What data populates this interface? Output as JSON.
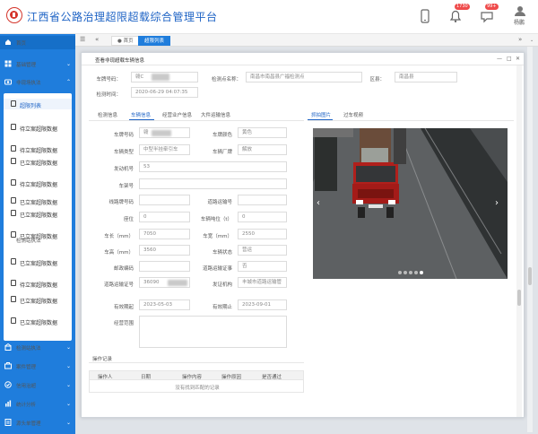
{
  "header": {
    "app_title": "江西省公路治理超限超载综合管理平台",
    "badge_alerts": "1730",
    "badge_msgs": "99+",
    "user": "杨鹏"
  },
  "sidebar": {
    "items": [
      {
        "label": "首页",
        "icon": "home-icon"
      },
      {
        "label": "基础管理",
        "icon": "grid-icon"
      },
      {
        "label": "非现场执法",
        "icon": "camera-icon"
      },
      {
        "label": "检测站执法",
        "icon": "station-icon"
      },
      {
        "label": "检测站执法",
        "icon": "station-icon"
      },
      {
        "label": "案件管理",
        "icon": "case-icon"
      },
      {
        "label": "信用治超",
        "icon": "credit-icon"
      },
      {
        "label": "统计分析",
        "icon": "chart-icon"
      },
      {
        "label": "源头单管理",
        "icon": "source-icon"
      }
    ],
    "group1": [
      {
        "label": "超限列表"
      },
      {
        "label": "待立案超限数据"
      },
      {
        "label": "待立案超限数据"
      },
      {
        "label": "已立案超限数据"
      },
      {
        "label": "待立案超限数据"
      },
      {
        "label": "已立案超限数据"
      },
      {
        "label": "已立案超限数据"
      },
      {
        "label": "已立案超限数据"
      }
    ],
    "group2": [
      {
        "label": "已立案超限数据"
      },
      {
        "label": "待立案超限数据"
      },
      {
        "label": "已立案超限数据"
      },
      {
        "label": "已立案超限数据"
      }
    ]
  },
  "tabbar": {
    "back": "«",
    "home_tab": "首页",
    "active_tab": "超限列表",
    "forward": "»"
  },
  "modal": {
    "title": "查看非现超载车辆信息",
    "ctrl_min": "—",
    "ctrl_max": "□",
    "ctrl_close": "✕",
    "plate_label": "车牌号码：",
    "plate_value": "赣C",
    "station_label": "检测点名称：",
    "station_value": "南昌市南昌县广福检测点",
    "area_label": "区县：",
    "area_value": "南昌县",
    "time_label": "检测时间：",
    "time_value": "2020-06-29 04:07:35",
    "subtabs": [
      "检测信息",
      "车辆信息",
      "经营业户信息",
      "大件运输信息"
    ],
    "active_subtab": "车辆信息",
    "photo_tabs": [
      "抓拍图片",
      "过车视频"
    ],
    "fields": {
      "plate_no_label": "车牌号码",
      "plate_no_value": "赣",
      "plate_color_label": "车牌颜色",
      "plate_color_value": "黄色",
      "vehicle_type_label": "车辆类型",
      "vehicle_type_value": "中型半挂牵引车",
      "brand_label": "车辆厂牌",
      "brand_value": "解放",
      "engine_label": "发动机号",
      "engine_value": "53",
      "frame_label": "车架号",
      "frame_value": "",
      "line_label": "线路牌号码",
      "line_value": "",
      "transport_no_label": "道路运输号",
      "transport_no_value": "",
      "seat_label": "座位",
      "seat_value": "0",
      "tonnage_label": "车辆吨位（t）",
      "tonnage_value": "0",
      "length_label": "车长（mm）",
      "length_value": "7050",
      "width_label": "车宽（mm）",
      "width_value": "2550",
      "height_label": "车高（mm）",
      "height_value": "3560",
      "status_label": "车辆状态",
      "status_value": "营运",
      "postcode_label": "邮政编码",
      "postcode_value": "",
      "has_permit_label": "道路运输证事",
      "has_permit_value": "否",
      "permit_no_label": "道路运输证号",
      "permit_no_value": "36090",
      "issuer_label": "发证机构",
      "issuer_value": "丰城市道路运输管理所",
      "valid_from_label": "有效期起",
      "valid_from_value": "2023-05-03",
      "valid_to_label": "有效期止",
      "valid_to_value": "2023-09-01",
      "scope_label": "经营范围",
      "scope_value": ""
    },
    "op_record": {
      "title": "操作记录",
      "columns": [
        "操作人",
        "日期",
        "操作内容",
        "操作原因",
        "是否通过"
      ],
      "empty_text": "没有找到匹配的记录"
    }
  }
}
